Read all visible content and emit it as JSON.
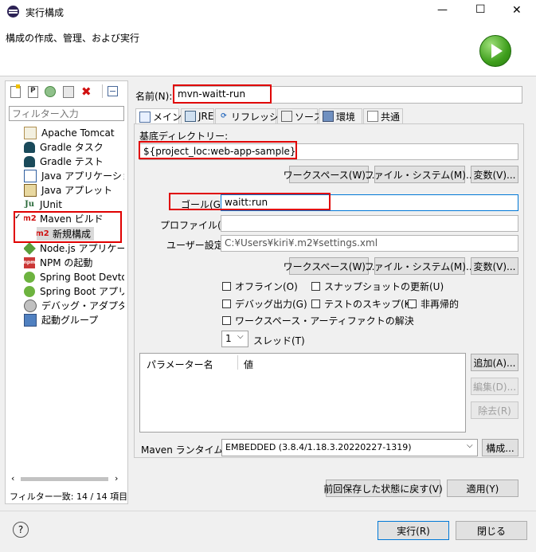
{
  "window": {
    "title": "実行構成",
    "controls": {
      "minimize": "—",
      "maximize": "☐",
      "close": "✕"
    }
  },
  "header": {
    "subtitle": "構成の作成、管理、および実行"
  },
  "filter": {
    "placeholder": "フィルター入力",
    "status": "フィルター一致: 14 / 14 項目"
  },
  "tree": {
    "items": [
      {
        "label": "Apache Tomcat",
        "icon": "tomcat-icon"
      },
      {
        "label": "Gradle タスク",
        "icon": "gradle-icon"
      },
      {
        "label": "Gradle テスト",
        "icon": "gradle-icon"
      },
      {
        "label": "Java アプリケーション",
        "icon": "java-app-icon"
      },
      {
        "label": "Java アプレット",
        "icon": "java-applet-icon"
      },
      {
        "label": "JUnit",
        "icon": "junit-icon"
      },
      {
        "label": "Maven ビルド",
        "icon": "maven-icon"
      },
      {
        "label": "新規構成",
        "icon": "maven-icon"
      },
      {
        "label": "Node.js アプリケーション",
        "icon": "nodejs-icon"
      },
      {
        "label": "NPM の起動",
        "icon": "npm-icon"
      },
      {
        "label": "Spring Boot Devtools",
        "icon": "spring-icon"
      },
      {
        "label": "Spring Boot アプリケーション",
        "icon": "spring-boot-icon"
      },
      {
        "label": "デバッグ・アダプター・ランチャー",
        "icon": "debug-icon"
      },
      {
        "label": "起動グループ",
        "icon": "launch-group-icon"
      }
    ],
    "maven_badge": "m2"
  },
  "form": {
    "name_label": "名前(N):",
    "name_value": "mvn-waitt-run",
    "tabs": [
      {
        "label": "メイン"
      },
      {
        "label": "JRE"
      },
      {
        "label": "リフレッシュ"
      },
      {
        "label": "ソース"
      },
      {
        "label": "環境"
      },
      {
        "label": "共通"
      }
    ],
    "base_dir_label": "基底ディレクトリー:",
    "base_dir_value": "${project_loc:web-app-sample}",
    "workspace_btn": "ワークスペース(W)...",
    "filesystem_btn": "ファイル・システム(M)...",
    "variables_btn": "変数(V)...",
    "goal_label": "ゴール(G):",
    "goal_value": "waitt:run",
    "profile_label": "プロファイル(P):",
    "profile_value": "",
    "user_settings_label": "ユーザー設定:",
    "user_settings_value": "C:¥Users¥kiri¥.m2¥settings.xml",
    "workspace_btn2": "ワークスペース(W)...",
    "filesystem_btn2": "ファイル・システム(M)...",
    "variables_btn2": "変数(V)...",
    "checkboxes": {
      "offline": "オフライン(O)",
      "snapshot": "スナップショットの更新(U)",
      "debug": "デバッグ出力(G)",
      "skip_tests": "テストのスキップ(K)",
      "non_recursive": "非再帰的",
      "resolve_ws": "ワークスペース・アーティファクトの解決"
    },
    "threads_value": "1",
    "threads_label": "スレッド(T)",
    "params_header_name": "パラメーター名",
    "params_header_value": "値",
    "add_btn": "追加(A)...",
    "edit_btn": "編集(D)...",
    "remove_btn": "除去(R)",
    "runtime_label": "Maven ランタイム(I):",
    "runtime_value": "EMBEDDED (3.8.4/1.18.3.20220227-1319)",
    "configure_btn": "構成...",
    "revert_btn": "前回保存した状態に戻す(V)",
    "apply_btn": "適用(Y)"
  },
  "footer": {
    "help": "?",
    "run_btn": "実行(R)",
    "close_btn": "閉じる"
  }
}
